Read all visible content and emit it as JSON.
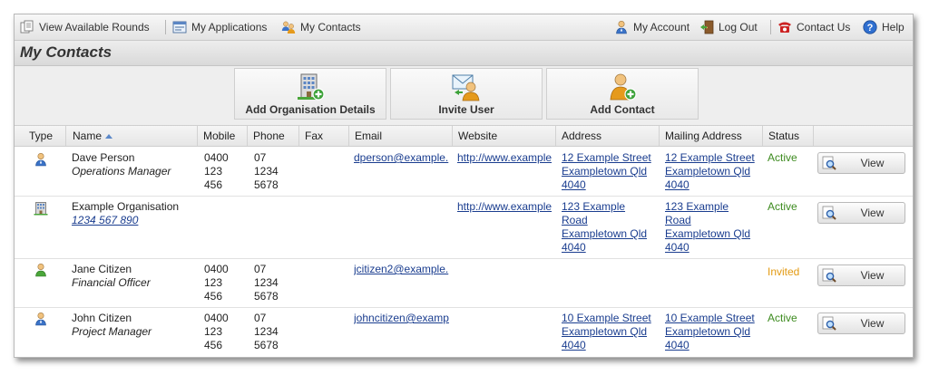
{
  "nav": {
    "view_rounds": "View Available Rounds",
    "my_applications": "My Applications",
    "my_contacts": "My Contacts",
    "my_account": "My Account",
    "log_out": "Log Out",
    "contact_us": "Contact Us",
    "help": "Help"
  },
  "page_title": "My Contacts",
  "actions": {
    "add_org": "Add Organisation Details",
    "invite_user": "Invite User",
    "add_contact": "Add Contact"
  },
  "columns": {
    "type": "Type",
    "name": "Name",
    "mobile": "Mobile",
    "phone": "Phone",
    "fax": "Fax",
    "email": "Email",
    "website": "Website",
    "address": "Address",
    "mailing": "Mailing Address",
    "status": "Status"
  },
  "view_label": "View",
  "rows": [
    {
      "type_icon": "person-blue-icon",
      "name": "Dave Person",
      "subtitle": "Operations Manager",
      "mobile": [
        "0400",
        "123",
        "456"
      ],
      "phone": [
        "07",
        "1234",
        "5678"
      ],
      "email": "dperson@example.",
      "website": "http://www.example",
      "address": [
        "12 Example Street",
        "Exampletown Qld",
        "4040"
      ],
      "mailing": [
        "12 Example Street",
        "Exampletown Qld",
        "4040"
      ],
      "status": "Active"
    },
    {
      "type_icon": "organisation-icon",
      "name": "Example Organisation",
      "subtitle": "1234 567 890",
      "mobile": [],
      "phone": [],
      "email": "",
      "website": "http://www.example",
      "address": [
        "123 Example",
        "Road",
        "Exampletown Qld",
        "4040"
      ],
      "mailing": [
        "123 Example",
        "Road",
        "Exampletown Qld",
        "4040"
      ],
      "status": "Active"
    },
    {
      "type_icon": "person-green-icon",
      "name": "Jane Citizen",
      "subtitle": "Financial Officer",
      "mobile": [
        "0400",
        "123",
        "456"
      ],
      "phone": [
        "07",
        "1234",
        "5678"
      ],
      "email": "jcitizen2@example.",
      "website": "",
      "address": [],
      "mailing": [],
      "status": "Invited"
    },
    {
      "type_icon": "person-blue-icon",
      "name": "John Citizen",
      "subtitle": "Project Manager",
      "mobile": [
        "0400",
        "123",
        "456"
      ],
      "phone": [
        "07",
        "1234",
        "5678"
      ],
      "email": "johncitizen@examp",
      "website": "",
      "address": [
        "10 Example Street",
        "Exampletown Qld",
        "4040"
      ],
      "mailing": [
        "10 Example Street",
        "Exampletown Qld",
        "4040"
      ],
      "status": "Active"
    }
  ],
  "colors": {
    "link": "#1a3d8f",
    "active": "#3d8b1f",
    "invited": "#e39a12"
  }
}
